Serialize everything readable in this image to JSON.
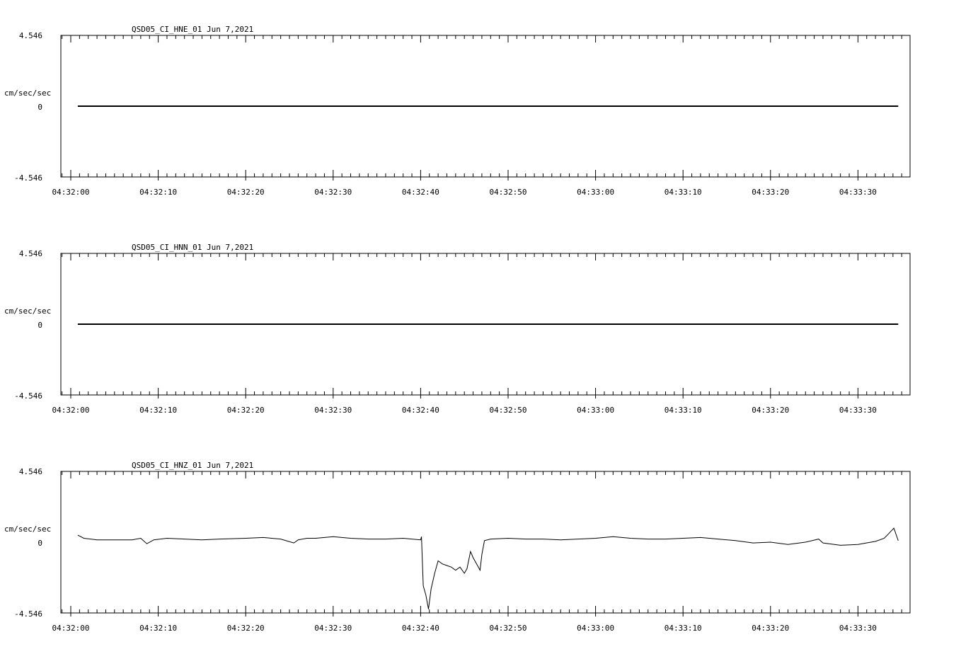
{
  "chart_data": [
    {
      "type": "line",
      "title": "QSD05_CI_HNE_01  Jun 7,2021",
      "ylabel": "cm/sec/sec",
      "ylim": [
        -4.546,
        4.546
      ],
      "y_ticks": [
        "4.546",
        "0",
        "-4.546"
      ],
      "x_tick_labels": [
        "04:32:00",
        "04:32:10",
        "04:32:20",
        "04:32:30",
        "04:32:40",
        "04:32:50",
        "04:33:00",
        "04:33:10",
        "04:33:20",
        "04:33:30"
      ],
      "xlim_seconds": [
        -1,
        96
      ],
      "series": [
        {
          "x": [
            0.8,
            94.6
          ],
          "y": [
            0,
            0
          ]
        }
      ]
    },
    {
      "type": "line",
      "title": "QSD05_CI_HNN_01  Jun 7,2021",
      "ylabel": "cm/sec/sec",
      "ylim": [
        -4.546,
        4.546
      ],
      "y_ticks": [
        "4.546",
        "0",
        "-4.546"
      ],
      "x_tick_labels": [
        "04:32:00",
        "04:32:10",
        "04:32:20",
        "04:32:30",
        "04:32:40",
        "04:32:50",
        "04:33:00",
        "04:33:10",
        "04:33:20",
        "04:33:30"
      ],
      "xlim_seconds": [
        -1,
        96
      ],
      "series": [
        {
          "x": [
            0.8,
            94.6
          ],
          "y": [
            0,
            0
          ]
        }
      ]
    },
    {
      "type": "line",
      "title": "QSD05_CI_HNZ_01  Jun 7,2021",
      "ylabel": "cm/sec/sec",
      "ylim": [
        -4.546,
        4.546
      ],
      "y_ticks": [
        "4.546",
        "0",
        "-4.546"
      ],
      "x_tick_labels": [
        "04:32:00",
        "04:32:10",
        "04:32:20",
        "04:32:30",
        "04:32:40",
        "04:32:50",
        "04:33:00",
        "04:33:10",
        "04:33:20",
        "04:33:30"
      ],
      "xlim_seconds": [
        -1,
        96
      ],
      "series": [
        {
          "x": [
            0.8,
            1.5,
            3,
            5,
            7,
            8,
            8.7,
            9.5,
            11,
            13,
            15,
            17,
            20,
            22,
            24,
            25.5,
            26,
            27,
            28,
            30,
            32,
            34,
            36,
            38,
            39,
            40,
            40.1,
            40.3,
            40.6,
            40.9,
            41.2,
            41.6,
            42,
            42.5,
            43,
            43.5,
            44,
            44.5,
            45,
            45.3,
            45.7,
            46,
            46.4,
            46.8,
            47,
            47.3,
            48,
            50,
            52,
            54,
            56,
            58,
            60,
            62,
            64,
            66,
            68,
            70,
            72,
            74,
            76,
            78,
            80,
            82,
            84,
            85.5,
            86,
            88,
            90,
            92,
            93,
            93.6,
            94.1,
            94.6
          ],
          "y": [
            0.45,
            0.25,
            0.15,
            0.15,
            0.15,
            0.25,
            -0.1,
            0.15,
            0.25,
            0.2,
            0.15,
            0.2,
            0.25,
            0.3,
            0.2,
            -0.05,
            0.15,
            0.25,
            0.25,
            0.35,
            0.25,
            0.2,
            0.2,
            0.25,
            0.2,
            0.15,
            0.35,
            -2.8,
            -3.4,
            -4.3,
            -3.0,
            -2.0,
            -1.2,
            -1.4,
            -1.5,
            -1.6,
            -1.8,
            -1.6,
            -2.0,
            -1.7,
            -0.6,
            -1.0,
            -1.4,
            -1.8,
            -0.8,
            0.1,
            0.2,
            0.25,
            0.2,
            0.2,
            0.15,
            0.2,
            0.25,
            0.35,
            0.25,
            0.2,
            0.2,
            0.25,
            0.3,
            0.2,
            0.1,
            -0.05,
            0.0,
            -0.15,
            0.0,
            0.2,
            -0.05,
            -0.2,
            -0.15,
            0.05,
            0.25,
            0.6,
            0.9,
            0.1
          ]
        }
      ]
    }
  ]
}
